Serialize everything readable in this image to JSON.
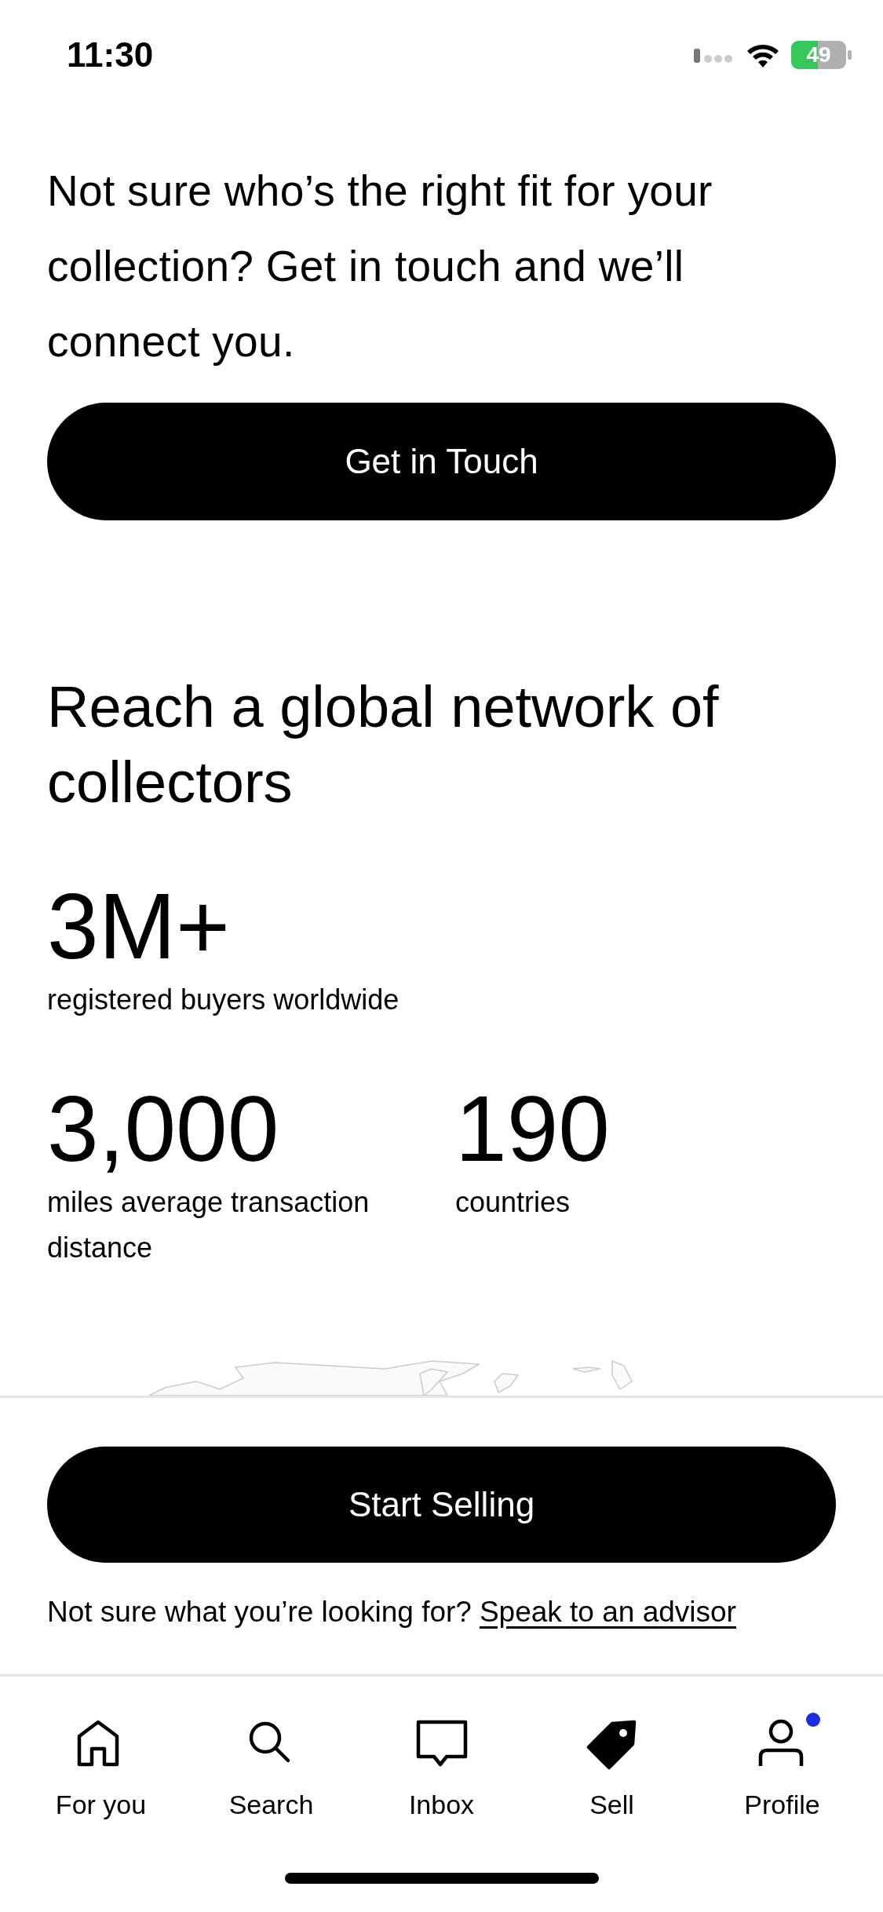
{
  "status_bar": {
    "time": "11:30",
    "battery": "49"
  },
  "intro": {
    "text": "Not sure who’s the right fit for your collection? Get in touch and we’ll connect you.",
    "button": "Get in Touch"
  },
  "network": {
    "heading": "Reach a global network of collectors",
    "stats": [
      {
        "value": "3M+",
        "label": "registered buyers worldwide"
      },
      {
        "value": "3,000",
        "label": "miles average transaction distance"
      },
      {
        "value": "190",
        "label": "countries"
      }
    ]
  },
  "footer": {
    "button": "Start Selling",
    "prompt": "Not sure what you’re looking for?",
    "link": "Speak to an advisor"
  },
  "tabs": [
    {
      "label": "For you",
      "kind": "home",
      "selected": false,
      "badge": false
    },
    {
      "label": "Search",
      "kind": "search",
      "selected": false,
      "badge": false
    },
    {
      "label": "Inbox",
      "kind": "inbox",
      "selected": false,
      "badge": false
    },
    {
      "label": "Sell",
      "kind": "tag",
      "selected": true,
      "badge": false
    },
    {
      "label": "Profile",
      "kind": "person",
      "selected": false,
      "badge": true
    }
  ]
}
